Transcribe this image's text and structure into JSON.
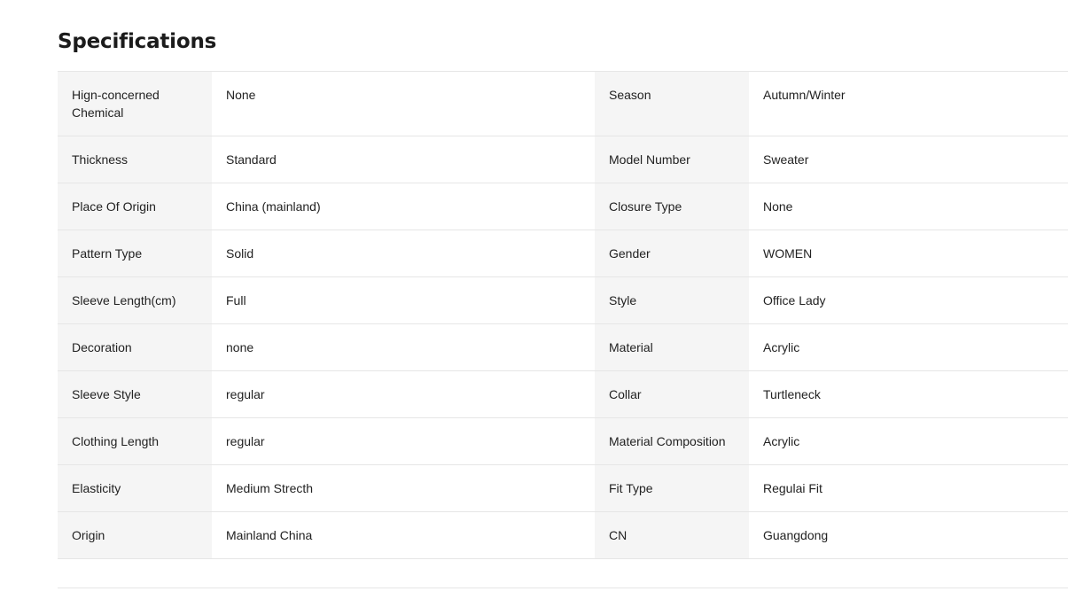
{
  "specifications": {
    "title": "Specifications",
    "rows": [
      {
        "left_name": "Hign-concerned Chemical",
        "left_value": "None",
        "right_name": "Season",
        "right_value": "Autumn/Winter"
      },
      {
        "left_name": "Thickness",
        "left_value": "Standard",
        "right_name": "Model Number",
        "right_value": "Sweater"
      },
      {
        "left_name": "Place Of Origin",
        "left_value": "China (mainland)",
        "right_name": "Closure Type",
        "right_value": "None"
      },
      {
        "left_name": "Pattern Type",
        "left_value": "Solid",
        "right_name": "Gender",
        "right_value": "WOMEN"
      },
      {
        "left_name": "Sleeve Length(cm)",
        "left_value": "Full",
        "right_name": "Style",
        "right_value": "Office Lady"
      },
      {
        "left_name": "Decoration",
        "left_value": "none",
        "right_name": "Material",
        "right_value": "Acrylic"
      },
      {
        "left_name": "Sleeve Style",
        "left_value": "regular",
        "right_name": "Collar",
        "right_value": "Turtleneck"
      },
      {
        "left_name": "Clothing Length",
        "left_value": "regular",
        "right_name": "Material Composition",
        "right_value": "Acrylic"
      },
      {
        "left_name": "Elasticity",
        "left_value": "Medium Strecth",
        "right_name": "Fit Type",
        "right_value": "Regulai Fit"
      },
      {
        "left_name": "Origin",
        "left_value": "Mainland China",
        "right_name": "CN",
        "right_value": "Guangdong"
      }
    ]
  }
}
